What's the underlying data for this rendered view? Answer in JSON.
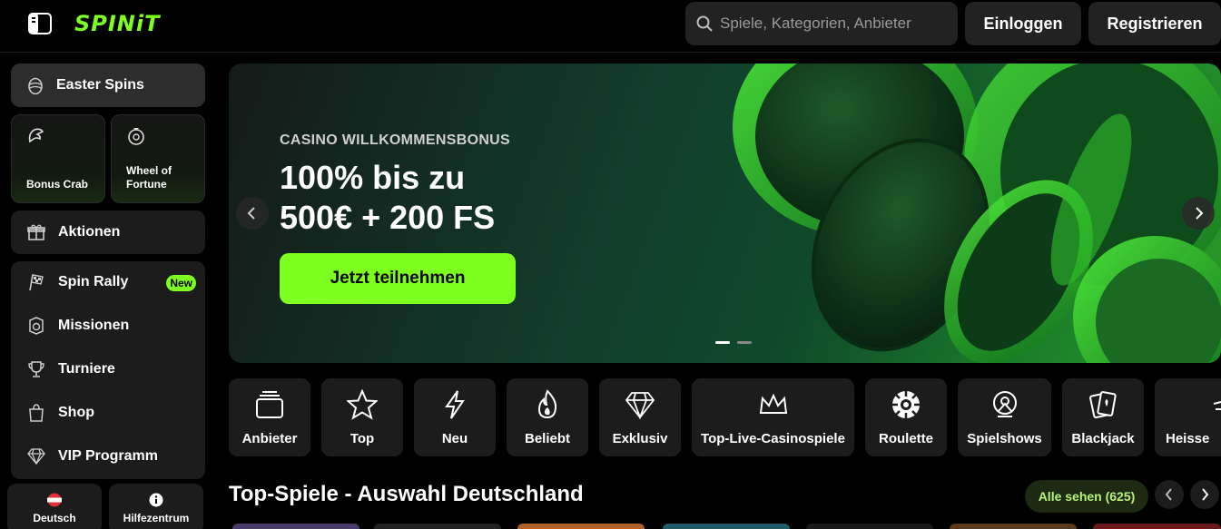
{
  "header": {
    "logo": "SPINiT",
    "search_placeholder": "Spiele, Kategorien, Anbieter",
    "login_label": "Einloggen",
    "register_label": "Registrieren"
  },
  "sidebar": {
    "easter_label": "Easter Spins",
    "tiles": [
      {
        "label": "Bonus Crab",
        "icon": "crab-claw-icon"
      },
      {
        "label": "Wheel of Fortune",
        "icon": "wheel-icon"
      }
    ],
    "aktionen_label": "Aktionen",
    "items": [
      {
        "label": "Spin Rally",
        "icon": "checkered-flag-icon",
        "badge": "New"
      },
      {
        "label": "Missionen",
        "icon": "mission-icon"
      },
      {
        "label": "Turniere",
        "icon": "trophy-icon"
      },
      {
        "label": "Shop",
        "icon": "shopping-bag-icon"
      },
      {
        "label": "VIP Programm",
        "icon": "diamond-icon"
      }
    ],
    "footer": [
      {
        "label": "Deutsch",
        "icon": "flag-austria-icon"
      },
      {
        "label": "Hilfezentrum",
        "icon": "info-icon"
      }
    ]
  },
  "banner": {
    "kicker": "CASINO WILLKOMMENSBONUS",
    "title_line1": "100% bis zu",
    "title_line2": "500€ + 200 FS",
    "cta": "Jetzt teilnehmen",
    "slide_count": 2,
    "active_slide": 1
  },
  "categories": [
    {
      "label": "Anbieter",
      "icon": "stack-icon"
    },
    {
      "label": "Top",
      "icon": "star-icon"
    },
    {
      "label": "Neu",
      "icon": "lightning-icon"
    },
    {
      "label": "Beliebt",
      "icon": "flame-icon"
    },
    {
      "label": "Exklusiv",
      "icon": "diamond-icon"
    },
    {
      "label": "Top-Live-Casinospiele",
      "icon": "crown-icon"
    },
    {
      "label": "Roulette",
      "icon": "roulette-icon"
    },
    {
      "label": "Spielshows",
      "icon": "microphone-icon"
    },
    {
      "label": "Blackjack",
      "icon": "cards-icon"
    },
    {
      "label": "Heisse",
      "icon": "hot-icon"
    }
  ],
  "section": {
    "title": "Top-Spiele - Auswahl Deutschland",
    "see_all": "Alle sehen (625)"
  },
  "colors": {
    "accent": "#7dff1f",
    "background": "#000000",
    "panel": "#1c1c1c"
  }
}
